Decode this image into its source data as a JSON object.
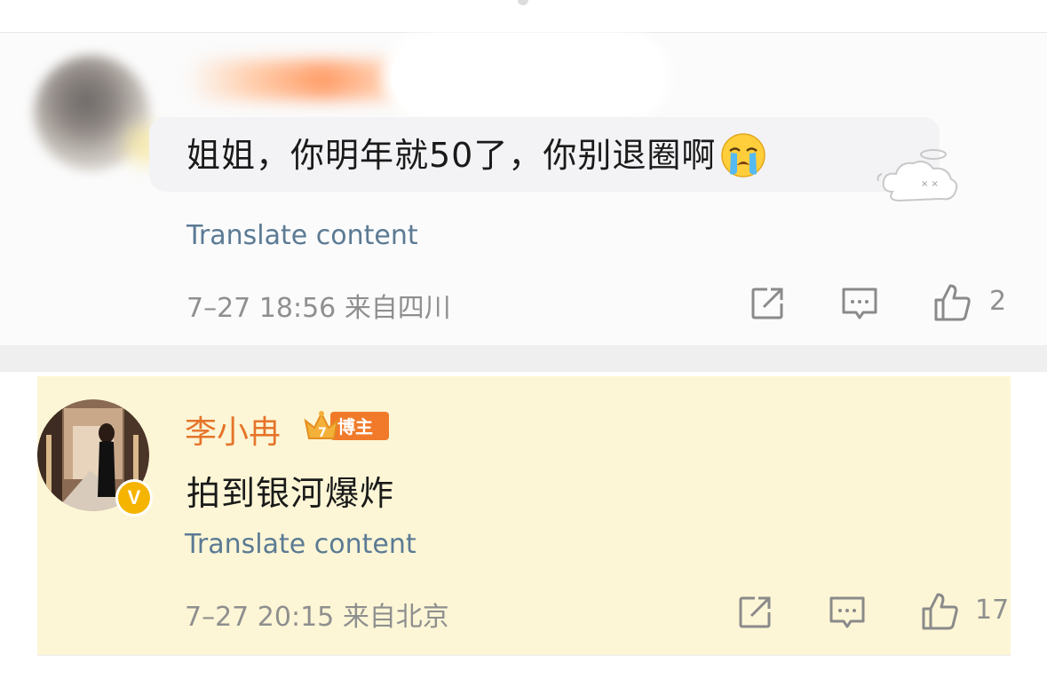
{
  "comments": [
    {
      "text": "姐姐，你明年就50了，你别退圈啊",
      "emoji": "loudly-crying-face",
      "translate_label": "Translate content",
      "time": "7–27 18:56",
      "location": "来自四川",
      "like_count": "2"
    },
    {
      "username": "李小冉",
      "badge": "博主",
      "badge_level": "7",
      "text": "拍到银河爆炸",
      "translate_label": "Translate content",
      "time": "7–27 20:15",
      "location": "来自北京",
      "like_count": "17"
    }
  ],
  "icons": {
    "share": "share-icon",
    "reply": "reply-icon",
    "like": "thumbs-up-icon",
    "verified": "verified-v-icon"
  },
  "colors": {
    "link": "#5b7a94",
    "username": "#e5742a",
    "highlight": "#fcf6d6",
    "verified": "#f5b400"
  }
}
